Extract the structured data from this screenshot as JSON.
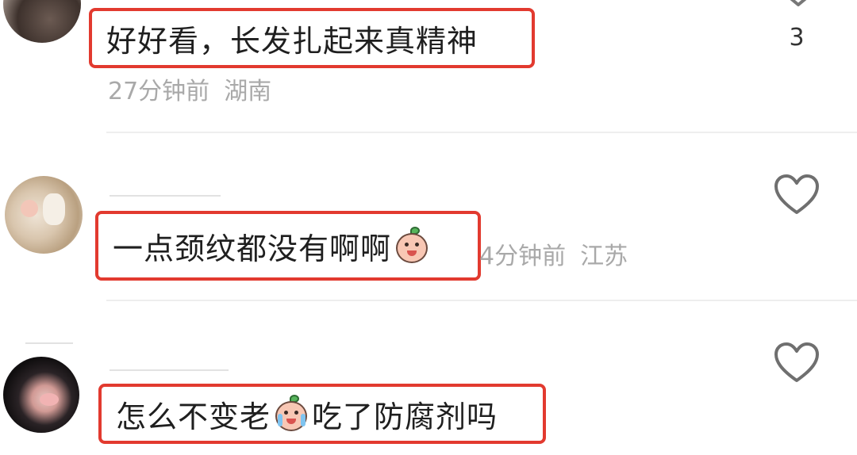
{
  "comments": [
    {
      "text": "好好看，长发扎起来真精神",
      "time": "27分钟前",
      "location": "湖南",
      "likes": "3"
    },
    {
      "text": "一点颈纹都没有啊啊",
      "emoji": "peach-hide-face-emoji",
      "time": "4分钟前",
      "location": "江苏"
    },
    {
      "text_before_emoji": "怎么不变老",
      "emoji": "peach-crying-emoji",
      "text_after_emoji": "吃了防腐剂吗"
    }
  ],
  "colors": {
    "highlight_border": "#e23a2f",
    "meta_text": "#a9a9a9",
    "body_text": "#1f1f1f"
  },
  "icons": [
    "heart-outline-icon",
    "chevron-icon"
  ]
}
